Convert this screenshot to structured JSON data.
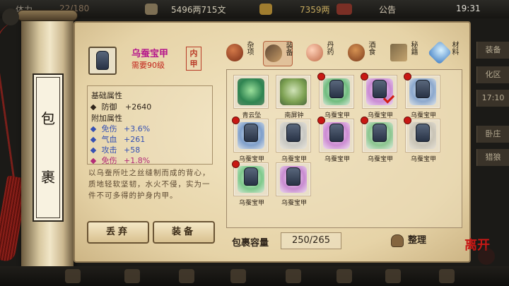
{
  "topbar": {
    "left_label": "体力",
    "stamina": "22/180",
    "money": "5496两715文",
    "currency": "7359两",
    "announcement": "公告",
    "time": "19:31"
  },
  "side_tabs": [
    "装备",
    "化区",
    "17:10",
    "卧庄",
    "猎狼"
  ],
  "scroll": {
    "title": [
      "包",
      "裹"
    ]
  },
  "item": {
    "name": "乌蚕宝甲",
    "requirement": "需要90级",
    "slot": "内甲",
    "base_heading": "基础属性",
    "base_stat": "防御",
    "base_value": "+2640",
    "extra_heading": "附加属性",
    "stats": [
      {
        "label": "免伤",
        "value": "+3.6%",
        "color": "#3651b3"
      },
      {
        "label": "气血",
        "value": "+261",
        "color": "#3651b3"
      },
      {
        "label": "攻击",
        "value": "+58",
        "color": "#3651b3"
      },
      {
        "label": "免伤",
        "value": "+1.8%",
        "color": "#b32b77"
      }
    ],
    "description": "以乌蚕所吐之丝缝制而成的背心，质地轻软坚韧，水火不侵，实为一件不可多得的护身内甲。"
  },
  "buttons": {
    "discard": "丢弃",
    "equip": "装备"
  },
  "categories": [
    "杂项",
    "装备",
    "丹药",
    "酒食",
    "秘籍",
    "材料"
  ],
  "inventory": [
    {
      "name": "青云坠",
      "icon": "green-pendant-icon"
    },
    {
      "name": "南屏钟",
      "icon": "bell-icon"
    },
    {
      "name": "乌蚕宝甲",
      "icon": "armor-icon"
    },
    {
      "name": "乌蚕宝甲",
      "icon": "armor-icon"
    },
    {
      "name": "乌蚕宝甲",
      "icon": "armor-icon"
    },
    {
      "name": "乌蚕宝甲",
      "icon": "armor-icon"
    },
    {
      "name": "乌蚕宝甲",
      "icon": "armor-icon"
    },
    {
      "name": "乌蚕宝甲",
      "icon": "armor-icon"
    },
    {
      "name": "乌蚕宝甲",
      "icon": "armor-icon"
    },
    {
      "name": "乌蚕宝甲",
      "icon": "armor-icon"
    },
    {
      "name": "乌蚕宝甲",
      "icon": "armor-icon"
    },
    {
      "name": "乌蚕宝甲",
      "icon": "armor-icon"
    }
  ],
  "capacity": {
    "label": "包裹容量",
    "value": "250/265"
  },
  "organize_label": "整理",
  "leave_label": "离开"
}
